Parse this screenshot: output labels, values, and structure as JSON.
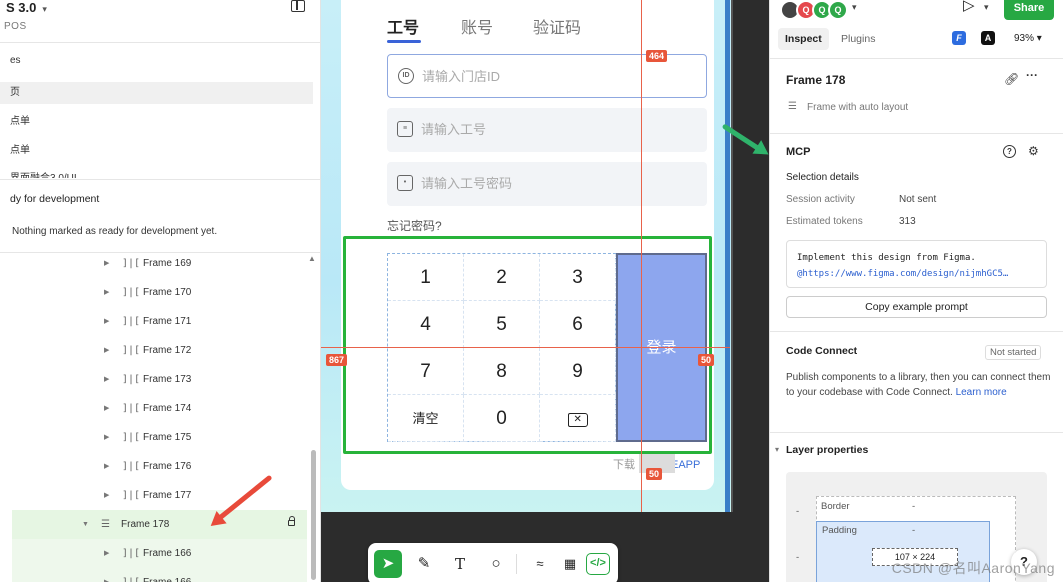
{
  "left_panel": {
    "title": "S 3.0",
    "subtitle": "POS",
    "pages": [
      "es",
      "页",
      "点单",
      "点单",
      "界面融合3.0/UI"
    ],
    "ready": {
      "title": "dy for development",
      "description": "Nothing marked as ready for development yet."
    },
    "layers": [
      "Frame 169",
      "Frame 170",
      "Frame 171",
      "Frame 172",
      "Frame 173",
      "Frame 174",
      "Frame 175",
      "Frame 176",
      "Frame 177"
    ],
    "selected_layer": "Frame 178",
    "child_layers": [
      "Frame 166",
      "Frame 166"
    ]
  },
  "canvas": {
    "tabs": [
      "工号",
      "账号",
      "验证码"
    ],
    "fields": [
      "请输入门店ID",
      "请输入工号",
      "请输入工号密码"
    ],
    "forgot_password": "忘记密码?",
    "keys": [
      "1",
      "2",
      "3",
      "4",
      "5",
      "6",
      "7",
      "8",
      "9",
      "清空",
      "0"
    ],
    "login_button": "登录",
    "download_prefix": "下载",
    "download_suffix": "EAPP",
    "measurements": {
      "top": "464",
      "left": "867",
      "right": "50",
      "bottom": "50"
    },
    "accent_color": "#27b33a"
  },
  "right_panel": {
    "avatars": [
      "Q",
      "Q",
      "Q"
    ],
    "share_label": "Share",
    "tabs": [
      "Inspect",
      "Plugins"
    ],
    "plugin_icons": [
      "F",
      "A"
    ],
    "zoom": "93%",
    "selection_title": "Frame 178",
    "selection_type": "Frame with auto layout",
    "mcp": {
      "title": "MCP",
      "selection_details": "Selection details",
      "session_label": "Session activity",
      "session_value": "Not sent",
      "tokens_label": "Estimated tokens",
      "tokens_value": "313",
      "prompt_line1": "Implement this design from Figma.",
      "prompt_line2": "@https://www.figma.com/design/nijmhGC5…",
      "copy_button": "Copy example prompt"
    },
    "code_connect": {
      "title": "Code Connect",
      "status": "Not started",
      "description": "Publish components to a library, then you can connect them to your codebase with Code Connect.",
      "learn_more": "Learn more"
    },
    "layer_properties": {
      "title": "Layer properties",
      "border_label": "Border",
      "border_value": "-",
      "padding_label": "Padding",
      "padding_value": "-",
      "left_value": "-",
      "size": "107 × 224"
    },
    "help": "?"
  },
  "watermark": "CSDN @名叫AaronYang"
}
